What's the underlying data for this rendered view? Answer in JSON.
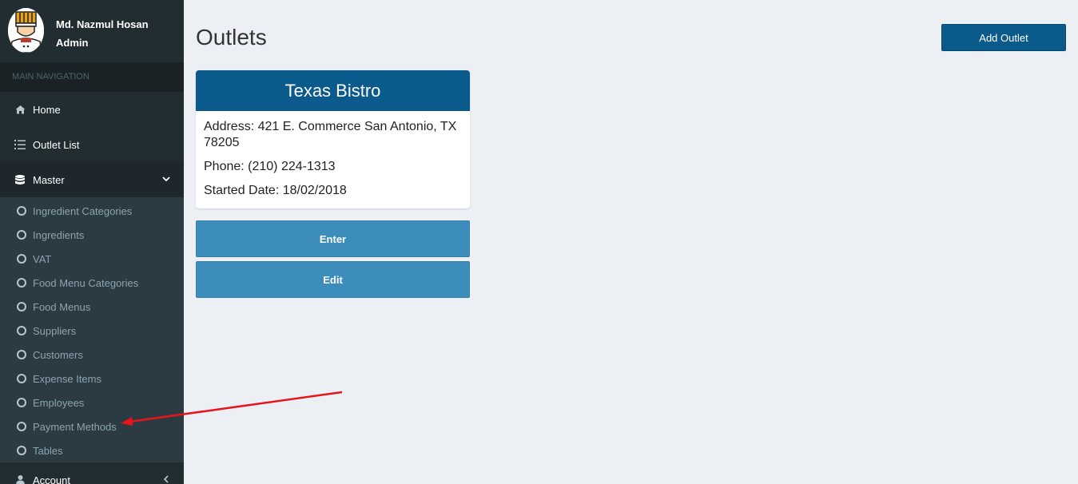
{
  "user": {
    "name": "Md. Nazmul Hosan",
    "role": "Admin"
  },
  "nav": {
    "header": "MAIN NAVIGATION",
    "items": [
      {
        "label": "Home",
        "icon": "home-icon"
      },
      {
        "label": "Outlet List",
        "icon": "list-icon"
      },
      {
        "label": "Master",
        "icon": "database-icon"
      }
    ],
    "submenu": [
      "Ingredient Categories",
      "Ingredients",
      "VAT",
      "Food Menu Categories",
      "Food Menus",
      "Suppliers",
      "Customers",
      "Expense Items",
      "Employees",
      "Payment Methods",
      "Tables"
    ],
    "account": {
      "label": "Account",
      "icon": "user-icon"
    }
  },
  "main": {
    "title": "Outlets",
    "add_button": "Add Outlet",
    "outlet": {
      "name": "Texas Bistro",
      "address": "Address: 421 E. Commerce San Antonio, TX 78205",
      "phone": "Phone: (210) 224-1313",
      "started": "Started Date: 18/02/2018"
    },
    "enter_button": "Enter",
    "edit_button": "Edit"
  },
  "colors": {
    "sidebar": "#222d32",
    "submenu": "#2c3b41",
    "primary_dark": "#0b5a8c",
    "primary": "#3c8dbc",
    "annotation_arrow": "#e8141b"
  }
}
